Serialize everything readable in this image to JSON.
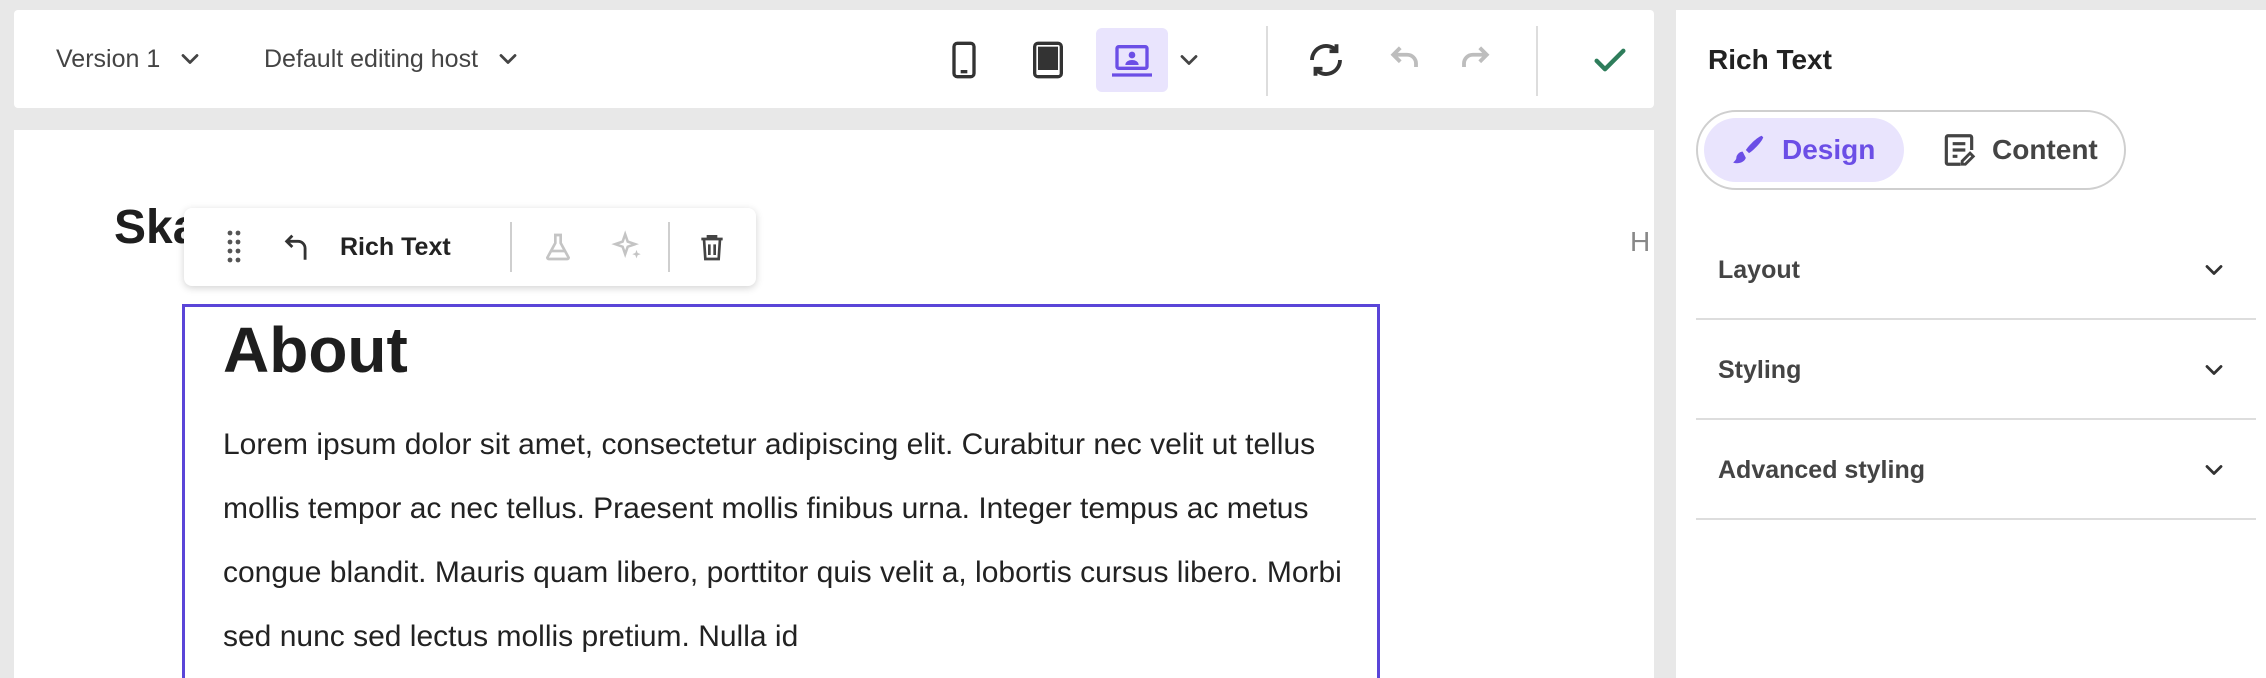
{
  "toolbar": {
    "version_label": "Version 1",
    "host_label": "Default editing host",
    "devices": [
      "phone-icon",
      "tablet-icon",
      "laptop-icon"
    ],
    "active_device": "laptop-icon",
    "accent": "#6b4ee6",
    "confirm_color": "#2e7d5b"
  },
  "canvas": {
    "site_title": "Ska",
    "nav_fragment": "H",
    "rt_toolbar": {
      "component_label": "Rich Text"
    },
    "block": {
      "heading": "About",
      "paragraph": "Lorem ipsum dolor sit amet, consectetur adipiscing elit. Curabitur nec velit ut tellus mollis tempor ac nec tellus. Praesent mollis finibus urna. Integer tempus ac metus congue blandit. Mauris quam libero, porttitor quis velit a, lobortis cursus libero. Morbi sed nunc sed lectus mollis pretium. Nulla id"
    }
  },
  "panel": {
    "title": "Rich Text",
    "tabs": {
      "design": "Design",
      "content": "Content",
      "active": "design"
    },
    "sections": [
      {
        "label": "Layout"
      },
      {
        "label": "Styling"
      },
      {
        "label": "Advanced styling"
      }
    ]
  }
}
